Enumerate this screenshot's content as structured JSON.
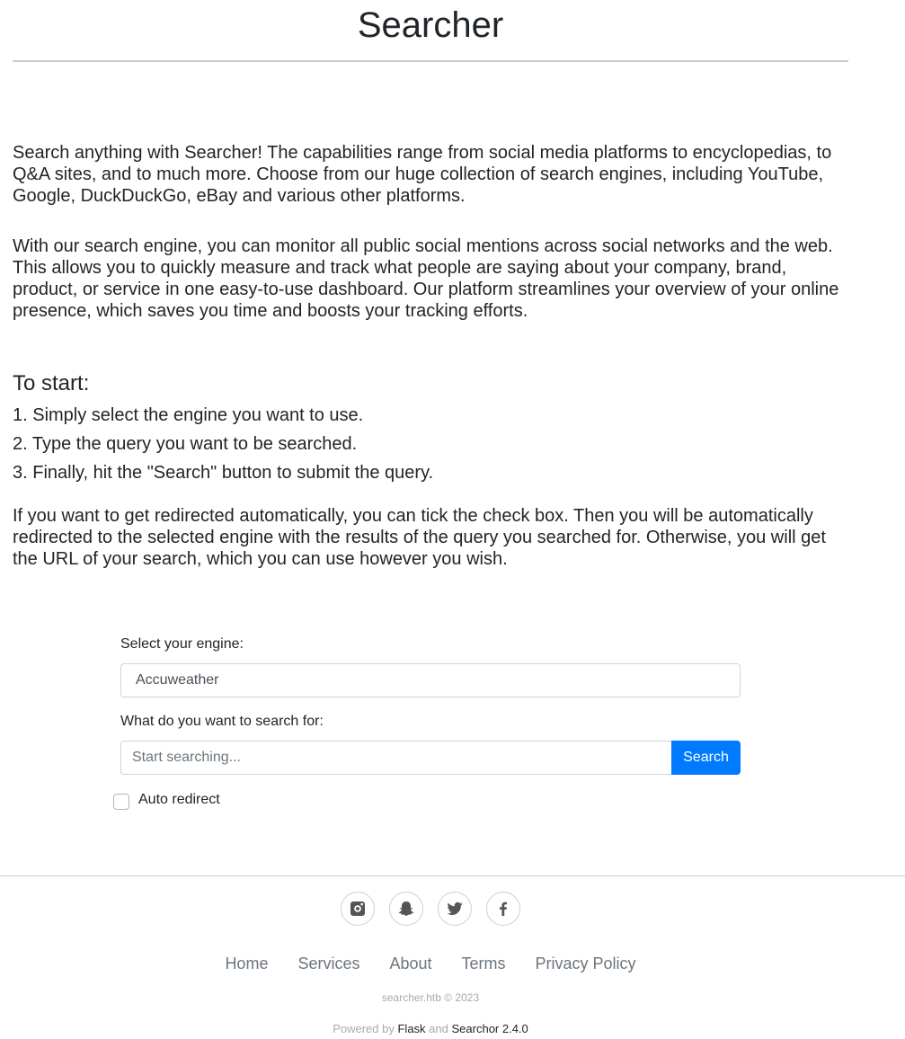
{
  "header": {
    "title": "Searcher"
  },
  "intro": {
    "paragraph_1": "Search anything with Searcher! The capabilities range from social media platforms to encyclopedias, to Q&A sites, and to much more. Choose from our huge collection of search engines, including YouTube, Google, DuckDuckGo, eBay and various other platforms.",
    "paragraph_2": "With our search engine, you can monitor all public social mentions across social networks and the web. This allows you to quickly measure and track what people are saying about your company, brand, product, or service in one easy-to-use dashboard. Our platform streamlines your overview of your online presence, which saves you time and boosts your tracking efforts."
  },
  "start": {
    "heading": "To start:",
    "steps": [
      "1. Simply select the engine you want to use.",
      "2. Type the query you want to be searched.",
      "3. Finally, hit the \"Search\" button to submit the query."
    ],
    "redirect_info": "If you want to get redirected automatically, you can tick the check box. Then you will be automatically redirected to the selected engine with the results of the query you searched for. Otherwise, you will get the URL of your search, which you can use however you wish."
  },
  "form": {
    "engine_label": "Select your engine:",
    "engine_selected": "Accuweather",
    "query_label": "What do you want to search for:",
    "query_placeholder": "Start searching...",
    "query_value": "",
    "search_button": "Search",
    "auto_redirect_label": "Auto redirect",
    "auto_redirect_checked": false,
    "accent_color": "#007bff"
  },
  "footer": {
    "social_icons": [
      "instagram-icon",
      "snapchat-icon",
      "twitter-icon",
      "facebook-icon"
    ],
    "nav": [
      "Home",
      "Services",
      "About",
      "Terms",
      "Privacy Policy"
    ],
    "copyright": "searcher.htb © 2023",
    "powered_prefix": "Powered by",
    "powered_flask": "Flask",
    "powered_and": "and",
    "powered_searchor": "Searchor 2.4.0"
  }
}
